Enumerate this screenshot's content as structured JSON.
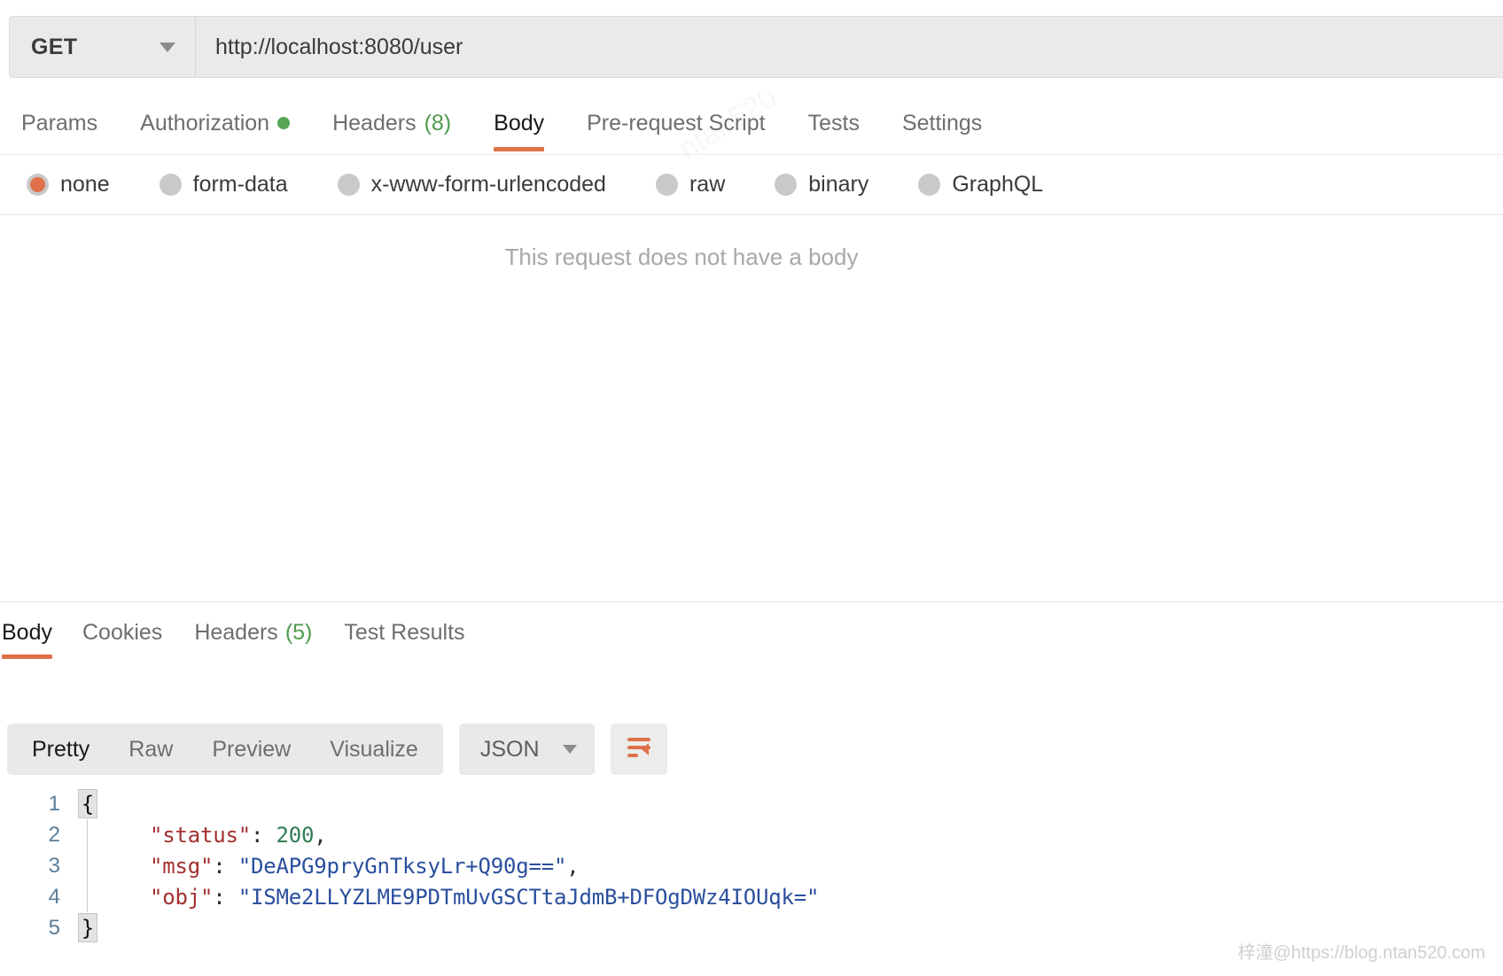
{
  "request": {
    "method": "GET",
    "url": "http://localhost:8080/user",
    "tabs": [
      {
        "label": "Params",
        "active": false,
        "dot": false,
        "count": ""
      },
      {
        "label": "Authorization",
        "active": false,
        "dot": true,
        "count": ""
      },
      {
        "label": "Headers",
        "active": false,
        "dot": false,
        "count": "(8)"
      },
      {
        "label": "Body",
        "active": true,
        "dot": false,
        "count": ""
      },
      {
        "label": "Pre-request Script",
        "active": false,
        "dot": false,
        "count": ""
      },
      {
        "label": "Tests",
        "active": false,
        "dot": false,
        "count": ""
      },
      {
        "label": "Settings",
        "active": false,
        "dot": false,
        "count": ""
      }
    ],
    "body_types": [
      {
        "label": "none",
        "checked": true
      },
      {
        "label": "form-data",
        "checked": false
      },
      {
        "label": "x-www-form-urlencoded",
        "checked": false
      },
      {
        "label": "raw",
        "checked": false
      },
      {
        "label": "binary",
        "checked": false
      },
      {
        "label": "GraphQL",
        "checked": false
      }
    ],
    "empty_body_message": "This request does not have a body"
  },
  "response": {
    "tabs": [
      {
        "label": "Body",
        "active": true,
        "count": ""
      },
      {
        "label": "Cookies",
        "active": false,
        "count": ""
      },
      {
        "label": "Headers",
        "active": false,
        "count": "(5)"
      },
      {
        "label": "Test Results",
        "active": false,
        "count": ""
      }
    ],
    "format_buttons": [
      {
        "label": "Pretty",
        "active": true
      },
      {
        "label": "Raw",
        "active": false
      },
      {
        "label": "Preview",
        "active": false
      },
      {
        "label": "Visualize",
        "active": false
      }
    ],
    "language": "JSON",
    "wrap_icon": "word-wrap-icon",
    "code_lines": [
      {
        "number": "1",
        "fold": "{",
        "segments": []
      },
      {
        "number": "2",
        "fold": "",
        "segments": [
          {
            "text": "    ",
            "cls": "k-punc"
          },
          {
            "text": "\"status\"",
            "cls": "k-key"
          },
          {
            "text": ": ",
            "cls": "k-punc"
          },
          {
            "text": "200",
            "cls": "k-num"
          },
          {
            "text": ",",
            "cls": "k-punc"
          }
        ]
      },
      {
        "number": "3",
        "fold": "",
        "segments": [
          {
            "text": "    ",
            "cls": "k-punc"
          },
          {
            "text": "\"msg\"",
            "cls": "k-key"
          },
          {
            "text": ": ",
            "cls": "k-punc"
          },
          {
            "text": "\"DeAPG9pryGnTksyLr+Q90g==\"",
            "cls": "k-str"
          },
          {
            "text": ",",
            "cls": "k-punc"
          }
        ]
      },
      {
        "number": "4",
        "fold": "",
        "segments": [
          {
            "text": "    ",
            "cls": "k-punc"
          },
          {
            "text": "\"obj\"",
            "cls": "k-key"
          },
          {
            "text": ": ",
            "cls": "k-punc"
          },
          {
            "text": "\"ISMe2LLYZLME9PDTmUvGSCTtaJdmB+DFOgDWz4IOUqk=\"",
            "cls": "k-str"
          }
        ]
      },
      {
        "number": "5",
        "fold": "}",
        "segments": []
      }
    ]
  },
  "watermark": {
    "corner": "梓潼@https://blog.ntan520.com",
    "diagonal": "ntan520"
  },
  "colors": {
    "accent": "#e0714a",
    "green": "#4e9a4e",
    "key": "#a2302f",
    "string": "#2b4f9e",
    "number": "#2e7d52",
    "toolbar_bg": "#e9e9e9"
  }
}
